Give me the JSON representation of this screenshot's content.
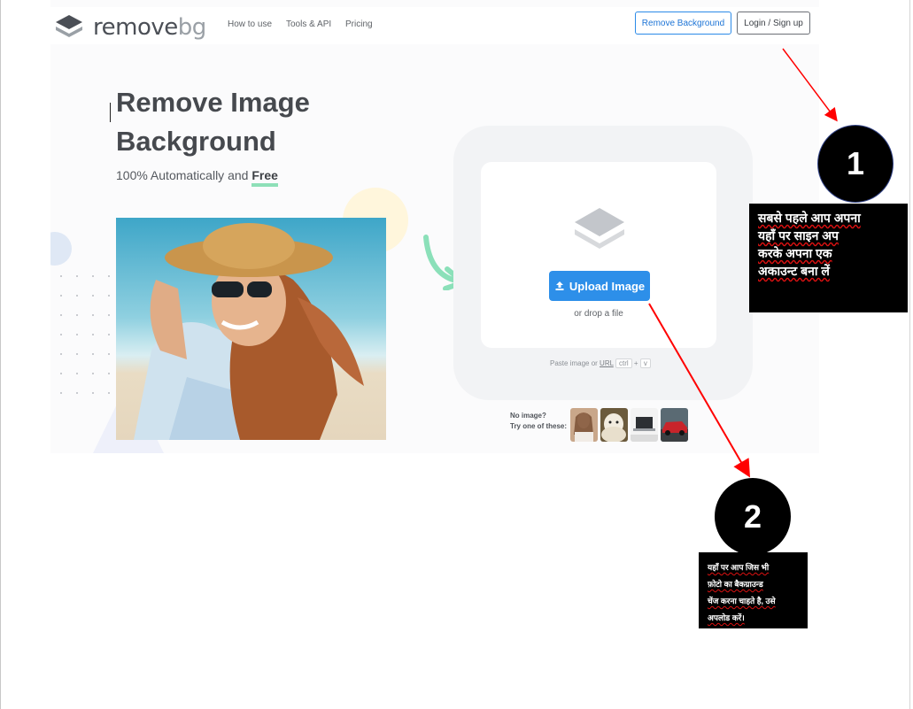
{
  "brand": {
    "logo_word": "remove",
    "logo_suffix": "bg"
  },
  "nav": {
    "links": [
      "How to use",
      "Tools & API",
      "Pricing"
    ],
    "remove_background_button": "Remove Background",
    "login_button": "Login / Sign up"
  },
  "hero": {
    "title_line1": "Remove Image",
    "title_line2": "Background",
    "subtitle_prefix": "100% Automatically and",
    "subtitle_emphasis": "Free"
  },
  "upload": {
    "button_label": "Upload Image",
    "drop_text": "or drop a file",
    "paste_prefix": "Paste image or",
    "paste_link": "URL",
    "key_ctrl": "ctrl",
    "key_plus": "+",
    "key_v": "v"
  },
  "samples": {
    "line1": "No image?",
    "line2": "Try one of these:"
  },
  "annotations": {
    "step1_number": "1",
    "step1_lines": [
      "सबसे पहले आप अपना",
      "यहाँ पर साइन अप",
      "करके अपना एक",
      "अकाउन्ट बना लें"
    ],
    "step2_number": "2",
    "step2_lines": [
      "यहाँ पर आप जिस भी",
      "फ़ोटो का बैकग्राउन्ड",
      "चेंज करना चाहते है, उसे",
      "अपलोड करें।"
    ]
  },
  "colors": {
    "accent_blue": "#2d8fe9",
    "annotation_red": "#ff0000",
    "highlight_green": "#8ee0b8"
  }
}
